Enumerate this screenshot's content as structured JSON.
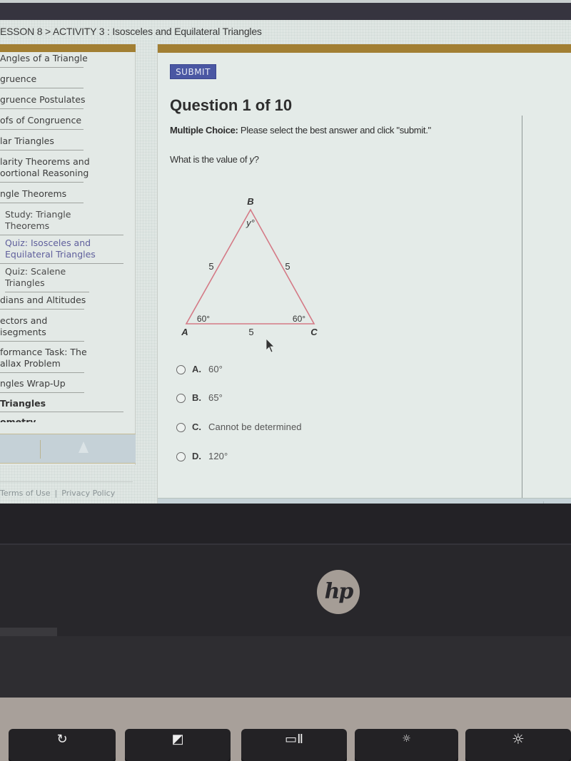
{
  "breadcrumb": {
    "text": "ESSON 8 > ACTIVITY 3 : Isosceles and Equilateral Triangles"
  },
  "sidebar": {
    "items": [
      {
        "label": "Angles of a Triangle",
        "type": "topic"
      },
      {
        "label": "gruence",
        "type": "topic"
      },
      {
        "label": "gruence Postulates",
        "type": "topic"
      },
      {
        "label": "ofs of Congruence",
        "type": "topic"
      },
      {
        "label": "lar Triangles",
        "type": "topic"
      },
      {
        "label": "larity Theorems and",
        "label2": "oortional Reasoning",
        "type": "topic"
      },
      {
        "label": "ngle Theorems",
        "type": "topic"
      },
      {
        "label": "Study: Triangle",
        "label2": "Theorems",
        "type": "activity"
      },
      {
        "label": "Quiz: Isosceles and",
        "label2": "Equilateral Triangles",
        "type": "activity",
        "active": true
      },
      {
        "label": "Quiz: Scalene",
        "label2": "Triangles",
        "type": "activity"
      },
      {
        "label": "dians and Altitudes",
        "type": "topic"
      },
      {
        "label": "ectors and",
        "label2": "isegments",
        "type": "topic"
      },
      {
        "label": "formance Task: The",
        "label2": "allax Problem",
        "type": "topic"
      },
      {
        "label": "ngles Wrap-Up",
        "type": "topic"
      },
      {
        "label": "Triangles",
        "type": "unit"
      },
      {
        "label": "ometry",
        "type": "unit"
      }
    ],
    "scroll_up_icon": "up-arrow-icon"
  },
  "footer": {
    "terms": "Terms of Use",
    "separator": "|",
    "privacy": "Privacy Policy"
  },
  "main": {
    "submit_label": "SUBMIT",
    "question_title": "Question 1 of 10",
    "instructions_bold": "Multiple Choice:",
    "instructions_text": " Please select the best answer and click \"submit.\"",
    "prompt_text": "What is the value of ",
    "prompt_var": "y",
    "prompt_end": "?",
    "figure": {
      "vertices": {
        "A": "A",
        "B": "B",
        "C": "C"
      },
      "side_AB": "5",
      "side_BC": "5",
      "side_AC": "5",
      "angle_A": "60°",
      "angle_C": "60°",
      "angle_B": "y°",
      "stroke_color": "#d47a86"
    },
    "choices": [
      {
        "letter": "A.",
        "text": "60°"
      },
      {
        "letter": "B.",
        "text": "65°"
      },
      {
        "letter": "C.",
        "text": "Cannot be determined"
      },
      {
        "letter": "D.",
        "text": "120°"
      }
    ]
  },
  "colors": {
    "header_bar": "#a27f33",
    "submit_bg": "#4a57a3",
    "active_nav": "#5f5f9c"
  },
  "laptop": {
    "brand": "hp",
    "keys": [
      {
        "icon": "refresh-icon",
        "glyph": "↻"
      },
      {
        "icon": "fullscreen-icon",
        "glyph": "◩"
      },
      {
        "icon": "overview-icon",
        "glyph": "▭Ⅱ"
      },
      {
        "icon": "brightness-down-icon",
        "glyph": "☼"
      },
      {
        "icon": "brightness-up-icon",
        "glyph": "☼"
      }
    ]
  }
}
